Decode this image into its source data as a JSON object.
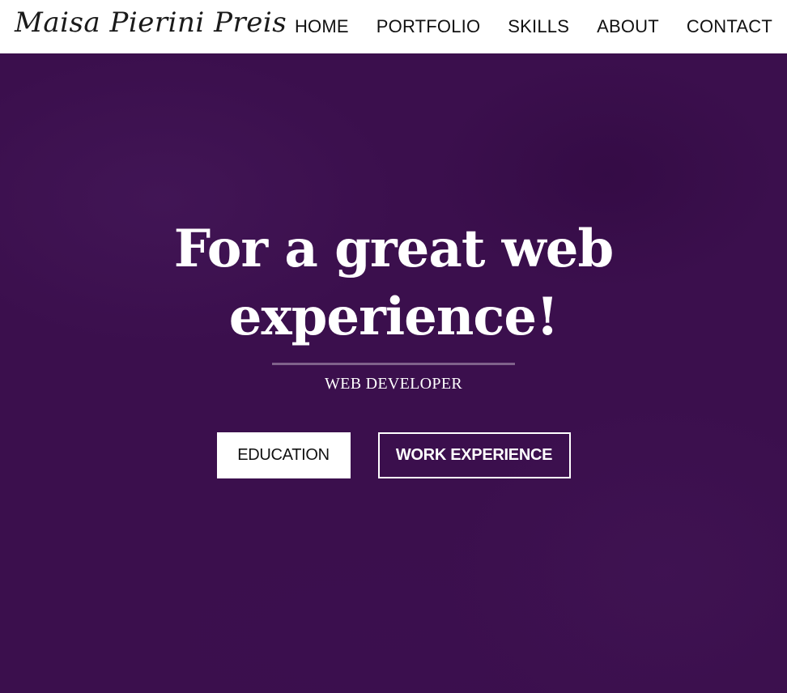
{
  "navbar": {
    "brand": "Maisa Pierini Preis",
    "links": [
      "HOME",
      "PORTFOLIO",
      "SKILLS",
      "ABOUT",
      "CONTACT"
    ]
  },
  "hero": {
    "headline": "For a great web experience!",
    "subtitle": "WEB DEVELOPER",
    "buttons": {
      "education": "EDUCATION",
      "work_experience": "WORK EXPERIENCE"
    }
  },
  "colors": {
    "hero_background": "#3b0f4d",
    "navbar_background": "#ffffff",
    "text_light": "#ffffff",
    "text_dark": "#111111"
  }
}
